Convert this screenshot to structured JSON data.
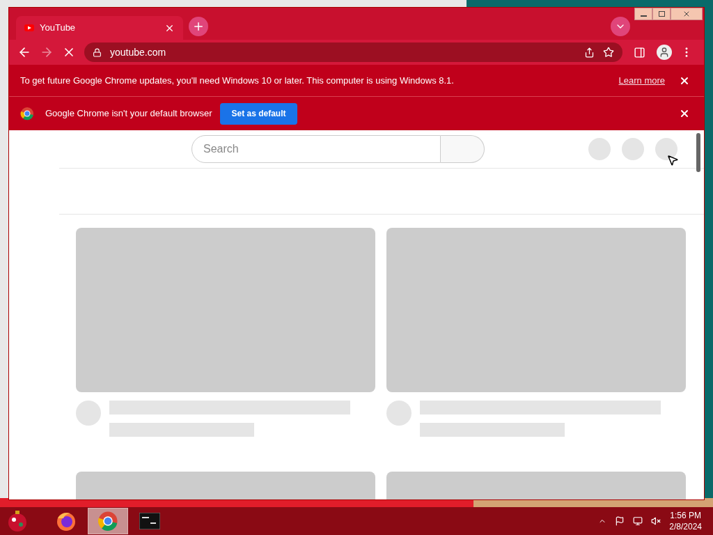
{
  "browser": {
    "tabs": [
      {
        "title": "YouTube",
        "selected": true
      }
    ],
    "address": "youtube.com",
    "loading": true
  },
  "infobars": [
    {
      "kind": "notice",
      "text": "To get future Google Chrome updates, you'll need Windows 10 or later. This computer is using Windows 8.1.",
      "link": "Learn more"
    },
    {
      "kind": "default-browser",
      "text": "Google Chrome isn't your default browser",
      "button": "Set as default"
    }
  ],
  "page": {
    "search": {
      "placeholder": "Search"
    }
  },
  "taskbar": {
    "apps": [
      {
        "kind": "firefox",
        "selected": false
      },
      {
        "kind": "chrome",
        "selected": true
      },
      {
        "kind": "terminal",
        "selected": false
      }
    ],
    "time": "1:56 PM",
    "date": "2/8/2024"
  }
}
